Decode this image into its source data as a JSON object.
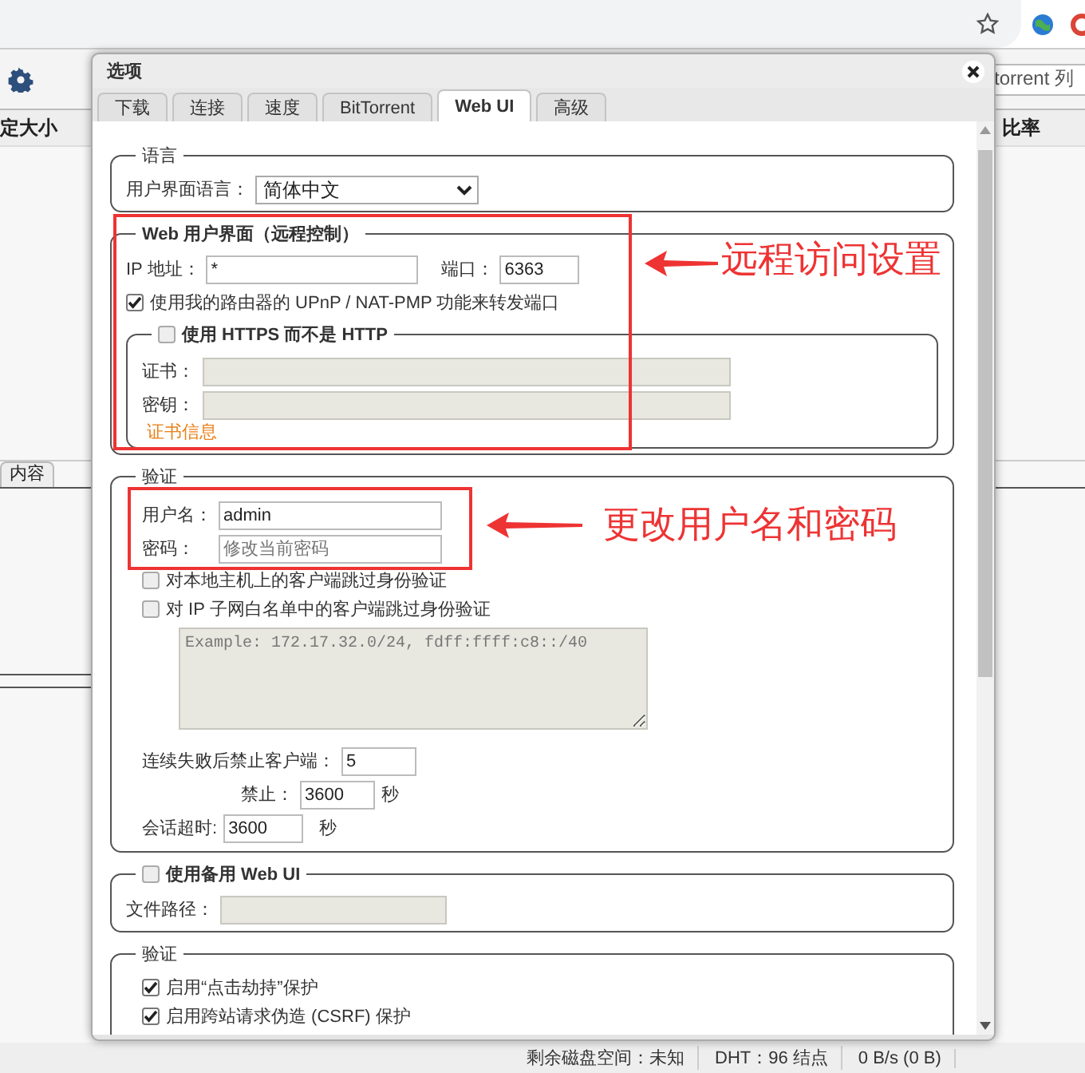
{
  "background": {
    "search": {
      "value": "torrent 列"
    },
    "columns": [
      "定大小",
      "比率"
    ],
    "tabs": [
      {
        "label": "内容"
      }
    ],
    "status_bar": [
      "剩余磁盘空间：未知",
      "DHT：96 结点",
      "0 B/s (0 B)"
    ]
  },
  "dialog": {
    "title": "选项",
    "tabs": [
      {
        "label": "下载",
        "selected": false
      },
      {
        "label": "连接",
        "selected": false
      },
      {
        "label": "速度",
        "selected": false
      },
      {
        "label": "BitTorrent",
        "selected": false
      },
      {
        "label": "Web UI",
        "selected": true
      },
      {
        "label": "高级",
        "selected": false
      }
    ],
    "language": {
      "legend": "语言",
      "label": "用户界面语言：",
      "value": "简体中文"
    },
    "web_ui": {
      "legend": "Web 用户界面（远程控制）",
      "ip_label": "IP 地址：",
      "ip_value": "*",
      "port_label": "端口：",
      "port_value": "6363",
      "upnp": {
        "label": "使用我的路由器的 UPnP / NAT-PMP 功能来转发端口",
        "checked": true
      },
      "https": {
        "label": "使用 HTTPS 而不是 HTTP",
        "checked": false,
        "cert_label": "证书：",
        "key_label": "密钥：",
        "link": "证书信息"
      }
    },
    "auth": {
      "legend": "验证",
      "username_label": "用户名：",
      "username": "admin",
      "password_label": "密码：",
      "password_placeholder": "修改当前密码",
      "options": [
        {
          "label": "对本地主机上的客户端跳过身份验证",
          "checked": false
        },
        {
          "label": "对 IP 子网白名单中的客户端跳过身份验证",
          "checked": false
        }
      ],
      "whitelist_placeholder": "Example: 172.17.32.0/24, fdff:ffff:c8::/40",
      "ban_label": "连续失败后禁止客户端：",
      "ban_value": "5",
      "ban_for_label": "禁止：",
      "ban_for_value": "3600",
      "ban_for_unit": "秒",
      "timeout_label": "会话超时:",
      "timeout_value": "3600",
      "timeout_unit": "秒"
    },
    "alt_ui": {
      "label": "使用备用 Web UI",
      "checked": false,
      "path_label": "文件路径："
    },
    "security": {
      "legend": "验证",
      "options": [
        {
          "label": "启用“点击劫持”保护",
          "checked": true
        },
        {
          "label": "启用跨站请求伪造 (CSRF) 保护",
          "checked": true
        }
      ]
    }
  },
  "annotations": [
    {
      "text": "远程访问设置"
    },
    {
      "text": "更改用户名和密码"
    }
  ]
}
